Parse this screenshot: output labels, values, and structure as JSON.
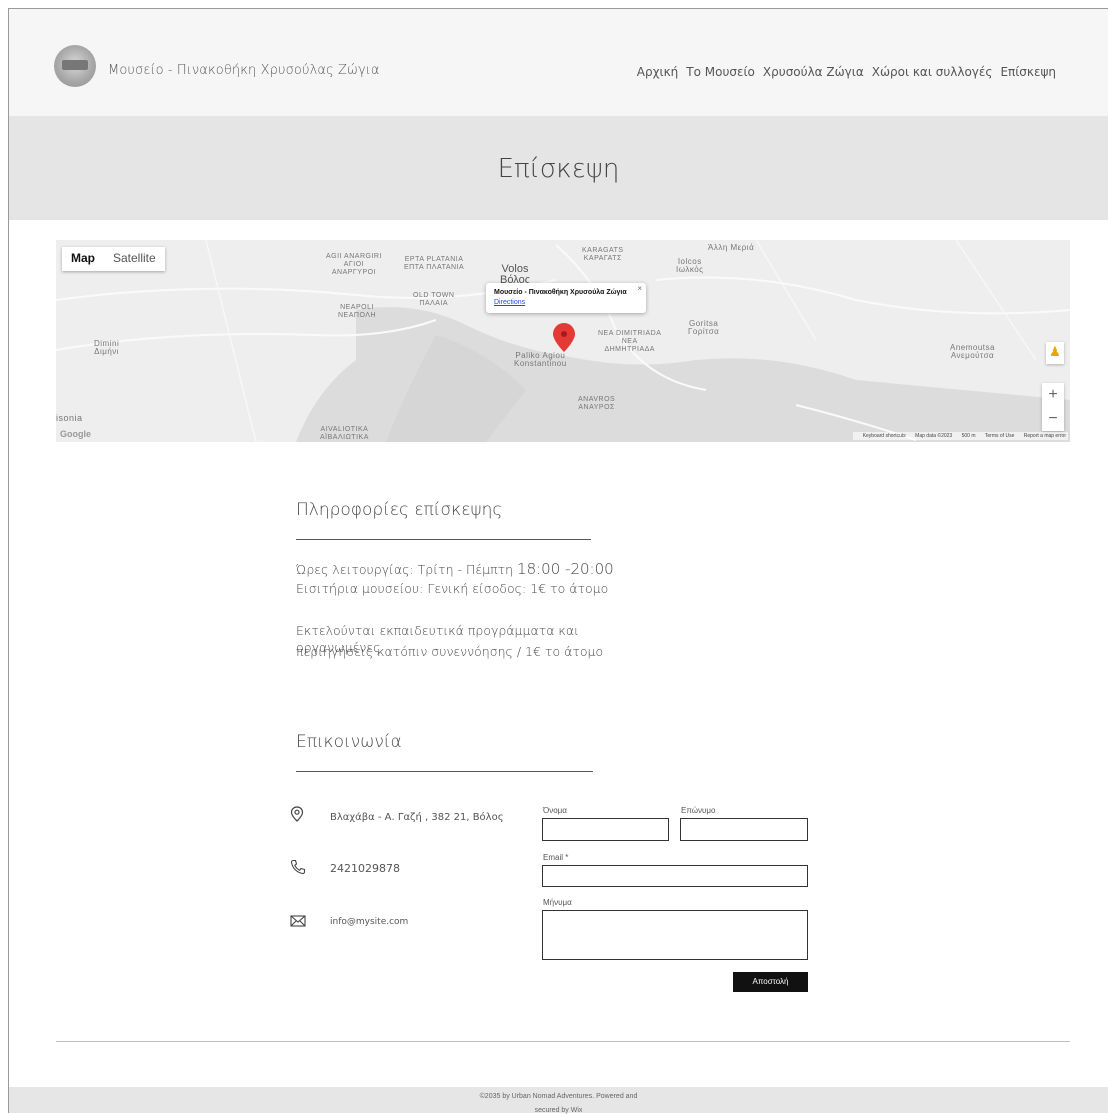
{
  "header": {
    "site_title": "Μουσείο - Πινακοθήκη Χρυσούλας Ζώγια",
    "nav": [
      "Αρχική",
      "Το Μουσείο",
      "Χρυσούλα Ζώγια",
      "Χώροι και συλλογές",
      "Επίσκεψη"
    ]
  },
  "banner": {
    "title": "Επίσκεψη"
  },
  "map": {
    "type_map": "Map",
    "type_satellite": "Satellite",
    "labels": {
      "agii1": "AGII ANARGIRI",
      "agii2": "ΑΓΙΟΙ",
      "agii3": "ΑΝΑΡΓΥΡΟΙ",
      "epta1": "EPTA PLATANIA",
      "epta2": "ΕΠΤΑ ΠΛΑΤΑΝΙΑ",
      "volos1": "Volos",
      "volos2": "Βόλος",
      "karagats1": "KARAGATS",
      "karagats2": "ΚΑΡΑΓΑΤΣ",
      "iolcos1": "Iolcos",
      "iolcos2": "Ιωλκός",
      "allh": "Άλλη Μεριά",
      "oldtown1": "OLD TOWN",
      "oldtown2": "ΠΑΛΑΙΑ",
      "neapoli1": "NEAPOLI",
      "neapoli2": "ΝΕΑΠΟΛΗ",
      "dimini1": "Dimini",
      "dimini2": "Διμήνι",
      "nea1": "NEA DIMITRIADA",
      "nea2": "ΝΕΑ",
      "nea3": "ΔΗΜΗΤΡΙΑΔΑ",
      "goritsa1": "Goritsa",
      "goritsa2": "Γορίτσα",
      "anemoutsa1": "Anemoutsa",
      "anemoutsa2": "Ανεμούτσα",
      "paliko1": "Paliko Agiou",
      "paliko2": "Konstantinou",
      "anavros1": "ANAVROS",
      "anavros2": "ΑΝΑΥΡΟΣ",
      "aivaliotika1": "AIVALIOTIKA",
      "aivaliotika2": "ΑΪΒΑΛΙΩΤΙΚΑ",
      "isonia": "isonia"
    },
    "info_title": "Μουσείο - Πινακοθήκη Χρυσούλα Ζώγια",
    "info_link": "Directions",
    "info_close": "×",
    "zoom_in": "+",
    "zoom_out": "−",
    "google": "Google",
    "attribution": [
      "Keyboard shortcuts",
      "Map data ©2023",
      "500 m",
      "Terms of Use",
      "Report a map error"
    ]
  },
  "visit": {
    "heading": "Πληροφορίες επίσκεψης",
    "hours_label": "Ώρες λειτουργίας: Τρίτη - Πέμπτη ",
    "hours_value": "18:00 -20:00",
    "tickets": "Εισιτήρια μουσείου: Γενική είσοδος: 1€ το άτομο",
    "programs_1": "Εκτελούνται εκπαιδευτικά προγράμματα και οργανωμένες",
    "programs_2": "περιηγήσεις κατόπιν συνεννόησης / 1€ το άτομο"
  },
  "contact": {
    "heading": "Επικοινωνία",
    "address": "Βλαχάβα - Α. Γαζή , 382 21, Βόλος",
    "phone": "2421029878",
    "email": "info@mysite.com",
    "form": {
      "first_name_label": "Όνομα",
      "last_name_label": "Επώνυμο",
      "email_label": "Email *",
      "message_label": "Μήνυμα",
      "submit": "Αποστολή"
    }
  },
  "footer": {
    "line1": "©2035 by Urban Nomad Adventures. Powered and",
    "line2": "secured by Wix"
  }
}
